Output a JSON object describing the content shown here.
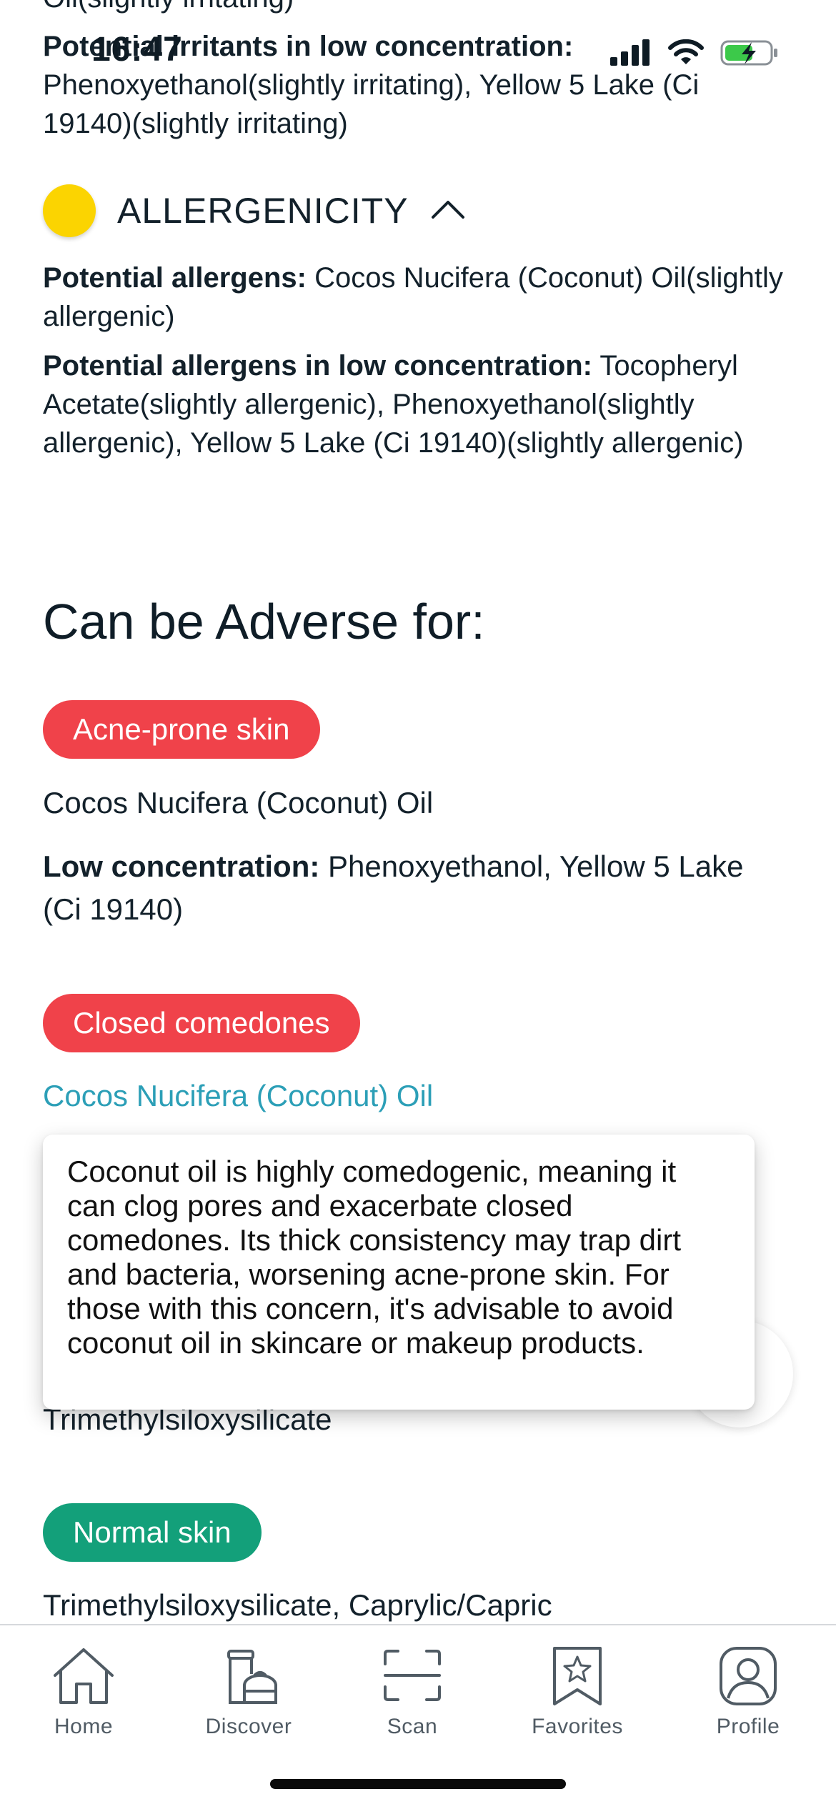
{
  "status_bar": {
    "time": "16:47",
    "icons": [
      "signal-icon",
      "wifi-icon",
      "battery-charging-icon"
    ]
  },
  "irritancy": {
    "top_partial_text": "Oil(slightly irritating)",
    "low_concentration_label": "Potential irritants in low concentration:",
    "low_concentration_value": " Phenoxyethanol(slightly irritating), Yellow 5 Lake (Ci 19140)(slightly irritating)"
  },
  "allergenicity": {
    "title": "ALLERGENICITY",
    "dot_color": "#fbd401",
    "allergens_label": "Potential allergens:",
    "allergens_value": " Cocos Nucifera (Coconut) Oil(slightly allergenic)",
    "low_concentration_label": "Potential allergens in low concentration:",
    "low_concentration_value": " Tocopheryl Acetate(slightly allergenic), Phenoxyethanol(slightly allergenic), Yellow 5 Lake (Ci 19140)(slightly allergenic)"
  },
  "adverse": {
    "title": "Can be Adverse for:",
    "items": [
      {
        "tag": "Acne-prone skin",
        "tag_color": "#f0424a",
        "ingredients": "Cocos Nucifera (Coconut) Oil",
        "low_concentration_label": "Low concentration:",
        "low_concentration_value": " Phenoxyethanol, Yellow 5 Lake (Ci 19140)"
      },
      {
        "tag": "Closed comedones",
        "tag_color": "#f0424a",
        "ingredients_link": "Cocos Nucifera (Coconut) Oil"
      }
    ]
  },
  "tooltip": {
    "text": "Coconut oil is highly comedogenic, meaning it can clog pores and exacerbate closed comedones. Its thick consistency may trap dirt and bacteria, worsening acne-prone skin. For those with this concern, it's advisable to avoid coconut oil in skincare or makeup products."
  },
  "beneficial": {
    "partial_ingredient": "Trimethylsiloxysilicate",
    "items": [
      {
        "tag": "Normal skin",
        "tag_color": "#13a07a",
        "ingredients": "Trimethylsiloxysilicate, Caprylic/Capric"
      }
    ]
  },
  "tab_bar": {
    "tabs": [
      {
        "label": "Home",
        "icon": "home-icon"
      },
      {
        "label": "Discover",
        "icon": "discover-icon"
      },
      {
        "label": "Scan",
        "icon": "scan-icon"
      },
      {
        "label": "Favorites",
        "icon": "favorites-icon"
      },
      {
        "label": "Profile",
        "icon": "profile-icon"
      }
    ]
  }
}
